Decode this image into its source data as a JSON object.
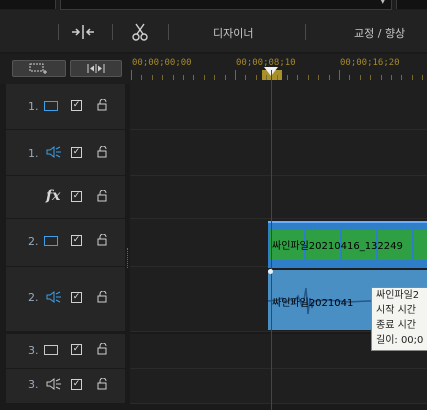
{
  "toolbar": {
    "split_icon": "split-icon",
    "cut_icon": "scissors-icon",
    "designer_label": "디자이너",
    "correction_label": "교정 / 향상"
  },
  "dropdown": {
    "arrow_icon": "caret-down-icon"
  },
  "ruler": {
    "timecodes": [
      "00;00;00;00",
      "00;00;08;10",
      "00;00;16;20"
    ]
  },
  "tracks": [
    {
      "number": "1.",
      "type": "video",
      "checked": true
    },
    {
      "number": "1.",
      "type": "audio",
      "checked": true
    },
    {
      "number": "",
      "type": "fx",
      "fx_label": "fx",
      "checked": true
    },
    {
      "number": "2.",
      "type": "video",
      "checked": true
    },
    {
      "number": "2.",
      "type": "audio",
      "checked": true
    },
    {
      "number": "3.",
      "type": "video",
      "checked": true
    },
    {
      "number": "3.",
      "type": "audio",
      "checked": true
    }
  ],
  "clips": {
    "video_label": "싸인파일20210416_132249",
    "audio_label": "싸인파일2021041"
  },
  "tooltip": {
    "line1": "싸인파일2",
    "line2": "시작 시간",
    "line3": "종료 시간",
    "line4": "길이: 00;0"
  },
  "colors": {
    "video_track": "#3ea0e8",
    "clip_video": "#2e7ec8",
    "clip_audio": "#4a8fc4",
    "playhead": "#b01818",
    "timecode": "#a58a2a"
  }
}
